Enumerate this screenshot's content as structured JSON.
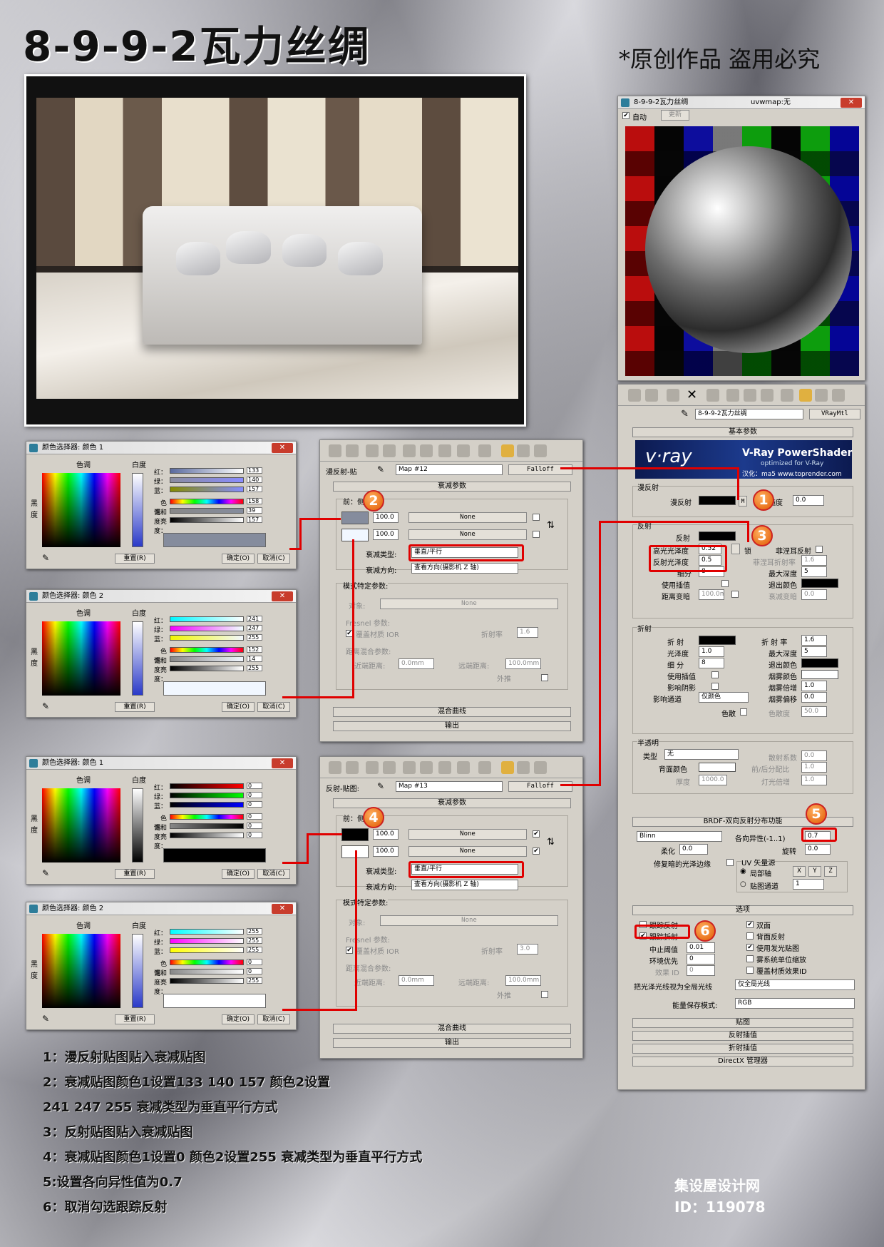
{
  "title": "8-9-9-2瓦力丝绸",
  "copyright": "*原创作品 盗用必究",
  "footer": {
    "site": "集设屋设计网",
    "id": "ID：119078"
  },
  "notes": [
    "1：漫反射贴图贴入衰减贴图",
    "2：衰减贴图颜色1设置133 140 157 颜色2设置",
    "241 247 255 衰减类型为垂直平行方式",
    "3：反射贴图贴入衰减贴图",
    "4：衰减贴图颜色1设置0 颜色2设置255 衰减类型为垂直平行方式",
    "5:设置各向异性值为0.7",
    "6：取消勾选跟踪反射"
  ],
  "badges": [
    "1",
    "2",
    "3",
    "4",
    "5",
    "6"
  ],
  "cs_common": {
    "hue": "色调",
    "white": "白度",
    "black": "黑",
    "degree": "度",
    "red": "红：",
    "green": "绿：",
    "blue": "蓝：",
    "hue2": "色调：",
    "sat": "饱和度：",
    "lum": "亮度：",
    "reset": "重置(R)",
    "ok": "确定(O)",
    "cancel": "取消(C)"
  },
  "cs": [
    {
      "title": "颜色选择器: 颜色 1",
      "values": [
        "133",
        "140",
        "157",
        "158",
        "39",
        "157"
      ],
      "swatch": "#858c9d"
    },
    {
      "title": "颜色选择器: 颜色 2",
      "values": [
        "241",
        "247",
        "255",
        "152",
        "14",
        "255"
      ],
      "swatch": "#f1f7ff"
    },
    {
      "title": "颜色选择器: 颜色 1",
      "values": [
        "0",
        "0",
        "0",
        "0",
        "0",
        "0"
      ],
      "swatch": "#000000"
    },
    {
      "title": "颜色选择器: 颜色 2",
      "values": [
        "255",
        "255",
        "255",
        "0",
        "0",
        "255"
      ],
      "swatch": "#ffffff"
    }
  ],
  "falloff_common": {
    "params": "衰减参数",
    "front_side": "前：侧",
    "none": "None",
    "type_label": "衰减类型:",
    "type_value": "垂直/平行",
    "dir_label": "衰减方向:",
    "dir_value": "查看方向(摄影机 Z 轴)",
    "mode_params": "模式特定参数:",
    "object": "对象:",
    "fresnel": "Fresnel 参数:",
    "override_ior": "覆盖材质 IOR",
    "ior_label": "折射率",
    "dist_params": "距离混合参数:",
    "near": "近端距离:",
    "far": "远端距离:",
    "near_v": "0.0mm",
    "far_v": "100.0mm",
    "extrap": "外推",
    "mix_curve": "混合曲线",
    "output": "输出",
    "falloff": "Falloff",
    "amount": "100.0"
  },
  "falloff": [
    {
      "slot": "漫反射-贴",
      "map": "Map #12",
      "ior": "1.6"
    },
    {
      "slot": "反射-贴图:",
      "map": "Map #13",
      "ior": "3.0"
    }
  ],
  "mat_editor": {
    "title": "8-9-9-2瓦力丝绸",
    "uvw": "uvwmap:无",
    "auto": "自动",
    "update": "更新"
  },
  "vray": {
    "mat_name": "8-9-9-2瓦力丝绸",
    "mat_type": "VRayMtl",
    "basic_params": "基本参数",
    "brand": "V-Ray PowerShader",
    "brand_sub": "optimized for V-Ray",
    "brand_credit": "汉化：ma5 www.toprender.com",
    "diffuse_group": "漫反射",
    "diffuse": "漫反射",
    "roughness": "粗糙度",
    "roughness_v": "0.0",
    "reflect_group": "反射",
    "reflect": "反射",
    "hilight": "高光光泽度",
    "hilight_v": "0.52",
    "lock": "锁",
    "refl_gloss": "反射光泽度",
    "refl_gloss_v": "0.5",
    "fresnel_refl": "菲涅耳反射",
    "fresnel_ior": "菲涅耳折射率",
    "fresnel_ior_v": "1.6",
    "subdivs": "细分",
    "subdivs_v": "8",
    "max_depth": "最大深度",
    "max_depth_v": "5",
    "use_interp": "使用插值",
    "exit_color": "退出颜色",
    "dim_dist": "距离变暗",
    "dim_dist_v": "100.0m",
    "dim_falloff": "衰减变暗",
    "dim_falloff_v": "0.0",
    "refract_group": "折射",
    "refract": "折 射",
    "ior": "折 射 率",
    "ior_v": "1.6",
    "gloss": "光泽度",
    "gloss_v": "1.0",
    "r_max_depth": "最大深度",
    "r_max_depth_v": "5",
    "r_subdivs": "细 分",
    "r_subdivs_v": "8",
    "r_exit": "退出颜色",
    "r_use_interp": "使用插值",
    "fog_color": "烟雾颜色",
    "shadow": "影响阴影",
    "fog_mult": "烟雾倍增",
    "fog_mult_v": "1.0",
    "affect_ch": "影响通道",
    "affect_ch_v": "仅颜色",
    "fog_bias": "烟雾偏移",
    "fog_bias_v": "0.0",
    "dispersion": "色散",
    "disp_abbe": "色散度",
    "disp_abbe_v": "50.0",
    "translucent": "半透明",
    "trans_type": "类型",
    "trans_type_v": "无",
    "scatter": "散射系数",
    "scatter_v": "0.0",
    "back_color": "背面颜色",
    "fb_coef": "前/后分配比",
    "fb_coef_v": "1.0",
    "thickness": "厚度",
    "thickness_v": "1000.0",
    "light_mult": "灯光倍增",
    "light_mult_v": "1.0",
    "brdf": "BRDF-双向反射分布功能",
    "brdf_type": "Blinn",
    "aniso": "各向异性(-1..1)",
    "aniso_v": "0.7",
    "soften": "柔化",
    "soften_v": "0.0",
    "rotation": "旋转",
    "rotation_v": "0.0",
    "fix_dark": "修复暗的光泽边缘",
    "uv_src": "UV 矢量源",
    "local_axis": "局部轴",
    "x": "X",
    "y": "Y",
    "z": "Z",
    "map_ch": "贴图通道",
    "map_ch_v": "1",
    "options": "选项",
    "trace_refl": "跟踪反射",
    "trace_refr": "跟踪折射",
    "cutoff": "中止阈值",
    "cutoff_v": "0.01",
    "env_prio": "环境优先",
    "env_prio_v": "0",
    "effect_id": "效果 ID",
    "effect_id_v": "0",
    "double_sided": "双面",
    "reflect_back": "背面反射",
    "use_irrad": "使用发光贴图",
    "fog_units": "雾系统单位缩放",
    "override_id": "覆盖材质效果ID",
    "treat_glossy": "把光泽光线视为全局光线",
    "treat_glossy_v": "仅全局光线",
    "energy": "能量保存模式:",
    "energy_v": "RGB",
    "maps": "贴图",
    "refl_interp": "反射插值",
    "refr_interp": "折射插值",
    "directx": "DirectX 管理器"
  }
}
